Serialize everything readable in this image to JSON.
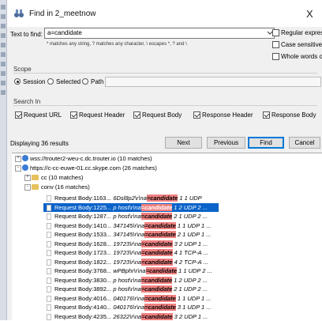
{
  "window": {
    "title": "Find in 2_meetnow",
    "close_glyph": "X"
  },
  "find": {
    "label": "Text to find:",
    "value": "a=candidate",
    "hint": "* matches any string, ? matches any character, \\ escapes *, ? and \\",
    "options": [
      {
        "label": "Regular expressi",
        "checked": false
      },
      {
        "label": "Case sensitive",
        "checked": false
      },
      {
        "label": "Whole words on",
        "checked": false
      }
    ]
  },
  "scope": {
    "header": "Scope",
    "options": [
      {
        "label": "Session",
        "selected": true
      },
      {
        "label": "Selected",
        "selected": false
      },
      {
        "label": "Path",
        "selected": false
      }
    ]
  },
  "search_in": {
    "header": "Search In",
    "options": [
      {
        "label": "Request URL",
        "checked": true
      },
      {
        "label": "Request Header",
        "checked": true
      },
      {
        "label": "Request Body",
        "checked": true
      },
      {
        "label": "Response Header",
        "checked": true
      },
      {
        "label": "Response Body",
        "checked": true
      }
    ]
  },
  "status": "Displaying 36 results",
  "buttons": {
    "next": "Next",
    "previous": "Previous",
    "find": "Find",
    "cancel": "Cancel"
  },
  "tree": {
    "nodes": [
      {
        "label": "wss://trouter2-weu-c.dc.trouter.io (10 matches)"
      },
      {
        "label": "https://c-cc-euwe-01.cc.skype.com (26 matches)"
      },
      {
        "label": "cc (10 matches)"
      },
      {
        "label": "conv (16 matches)"
      }
    ],
    "rows": [
      {
        "name": "Request Body:1163",
        "pre": "... 6Dsl8p2\\r\\na",
        "match": "=candidate",
        "post": " 1 1 UDP",
        "selected": false
      },
      {
        "name": "Request Body:1225",
        "pre": "... p host\\r\\na",
        "match": "=candidate",
        "post": " 1 2 UDP 2 ...",
        "selected": true
      },
      {
        "name": "Request Body:1287",
        "pre": "... p host\\r\\na",
        "match": "=candidate",
        "post": " 2 1 UDP 2 ...",
        "selected": false
      },
      {
        "name": "Request Body:1410",
        "pre": "... 347145\\r\\na",
        "match": "=candidate",
        "post": " 1 1 UDP 1 ...",
        "selected": false
      },
      {
        "name": "Request Body:1533",
        "pre": "... 347145\\r\\na",
        "match": "=candidate",
        "post": " 2 1 UDP 1 ...",
        "selected": false
      },
      {
        "name": "Request Body:1628",
        "pre": "... 19723\\r\\na",
        "match": "=candidate",
        "post": " 3 2 UDP 1 ...",
        "selected": false
      },
      {
        "name": "Request Body:1723",
        "pre": "... 19723\\r\\na",
        "match": "=candidate",
        "post": " 4 1 TCP-A ...",
        "selected": false
      },
      {
        "name": "Request Body:1822",
        "pre": "... 19723\\r\\na",
        "match": "=candidate",
        "post": " 4 2 TCP-A ...",
        "selected": false
      },
      {
        "name": "Request Body:3768",
        "pre": "... wPBphr\\r\\na",
        "match": "=candidate",
        "post": " 1 1 UDP 2 ...",
        "selected": false
      },
      {
        "name": "Request Body:3830",
        "pre": "... p host\\r\\na",
        "match": "=candidate",
        "post": " 1 2 UDP 2 ...",
        "selected": false
      },
      {
        "name": "Request Body:3892",
        "pre": "... p host\\r\\na",
        "match": "=candidate",
        "post": " 2 1 UDP 2 ...",
        "selected": false
      },
      {
        "name": "Request Body:4016",
        "pre": "... 040176\\r\\na",
        "match": "=candidate",
        "post": " 1 1 UDP 1 ...",
        "selected": false
      },
      {
        "name": "Request Body:4140",
        "pre": "... 040176\\r\\na",
        "match": "=candidate",
        "post": " 3 1 UDP 1 ...",
        "selected": false
      },
      {
        "name": "Request Body:4235",
        "pre": "... 26322\\r\\na",
        "match": "=candidate",
        "post": " 3 2 UDP 1 ...",
        "selected": false
      }
    ]
  }
}
